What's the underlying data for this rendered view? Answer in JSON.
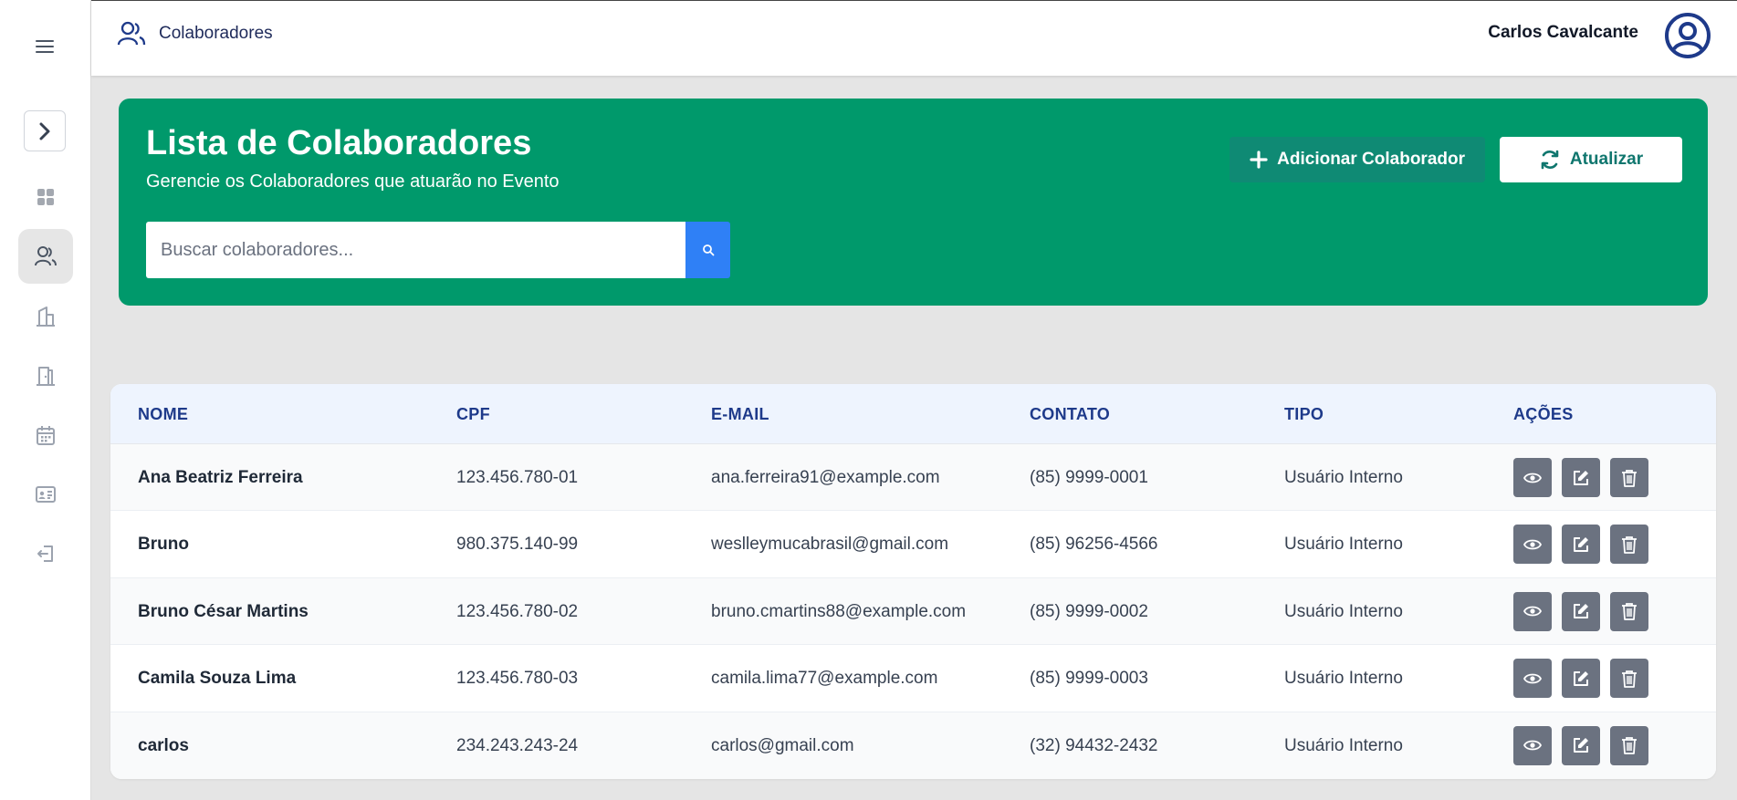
{
  "header": {
    "section_title": "Colaboradores",
    "user_name": "Carlos Cavalcante"
  },
  "sidebar": {
    "items": [
      {
        "icon": "dashboard-icon"
      },
      {
        "icon": "users-icon",
        "active": true
      },
      {
        "icon": "building-icon"
      },
      {
        "icon": "door-icon"
      },
      {
        "icon": "calendar-icon"
      },
      {
        "icon": "id-card-icon"
      },
      {
        "icon": "logout-icon"
      }
    ]
  },
  "banner": {
    "title": "Lista de Colaboradores",
    "subtitle": "Gerencie os Colaboradores que atuarão no Evento",
    "search_placeholder": "Buscar colaboradores...",
    "add_button_label": "Adicionar Colaborador",
    "refresh_button_label": "Atualizar",
    "colors": {
      "background": "#00996b",
      "add_button": "#0f8a74",
      "search_button": "#2f80f6"
    }
  },
  "table": {
    "headers": {
      "nome": "NOME",
      "cpf": "CPF",
      "email": "E-MAIL",
      "contato": "CONTATO",
      "tipo": "TIPO",
      "acoes": "AÇÕES"
    },
    "rows": [
      {
        "nome": "Ana Beatriz Ferreira",
        "cpf": "123.456.780-01",
        "email": "ana.ferreira91@example.com",
        "contato": "(85) 9999-0001",
        "tipo": "Usuário Interno"
      },
      {
        "nome": "Bruno",
        "cpf": "980.375.140-99",
        "email": "weslleymucabrasil@gmail.com",
        "contato": "(85) 96256-4566",
        "tipo": "Usuário Interno"
      },
      {
        "nome": "Bruno César Martins",
        "cpf": "123.456.780-02",
        "email": "bruno.cmartins88@example.com",
        "contato": "(85) 9999-0002",
        "tipo": "Usuário Interno"
      },
      {
        "nome": "Camila Souza Lima",
        "cpf": "123.456.780-03",
        "email": "camila.lima77@example.com",
        "contato": "(85) 9999-0003",
        "tipo": "Usuário Interno"
      },
      {
        "nome": "carlos",
        "cpf": "234.243.243-24",
        "email": "carlos@gmail.com",
        "contato": "(32) 94432-2432",
        "tipo": "Usuário Interno"
      }
    ],
    "row_actions": [
      "eye-icon",
      "edit-icon",
      "trash-icon"
    ]
  }
}
